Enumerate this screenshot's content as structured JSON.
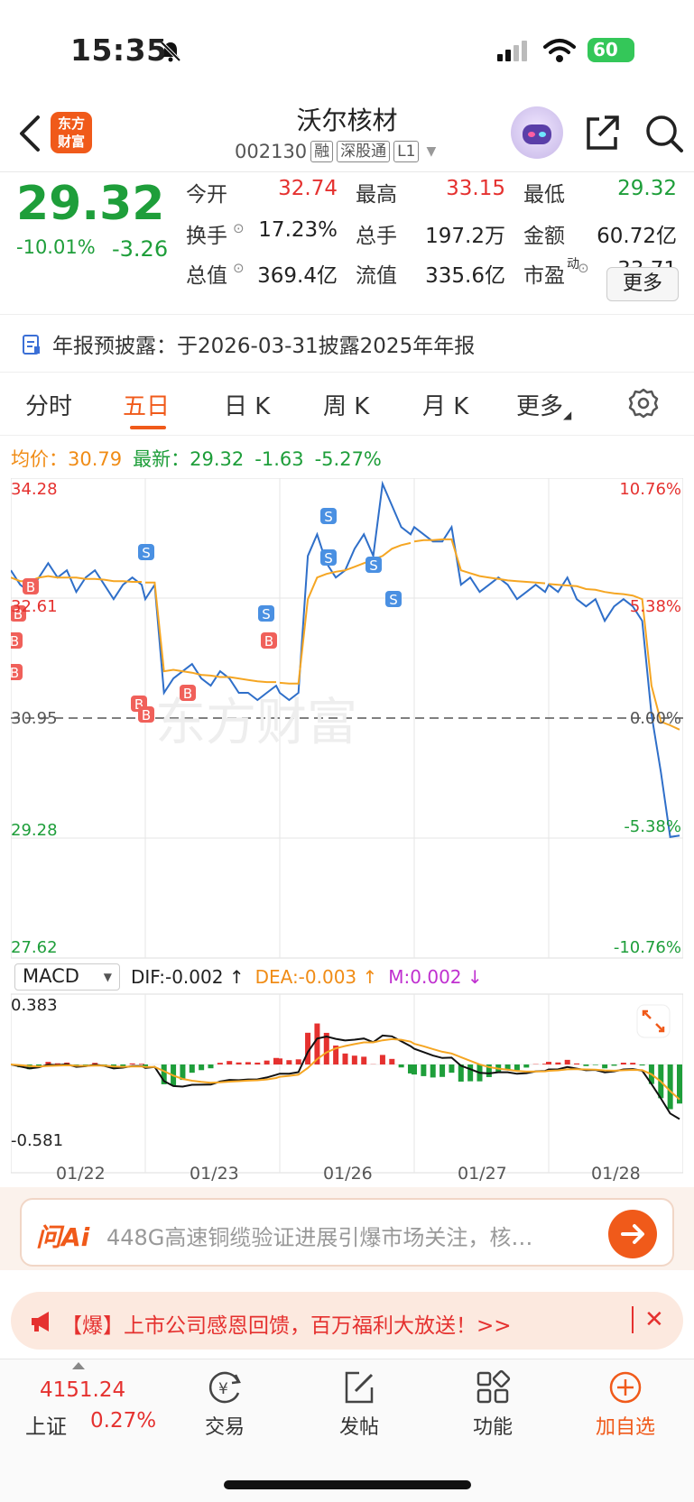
{
  "status_bar": {
    "time": "15:35",
    "battery": "60"
  },
  "header": {
    "title": "沃尔核材",
    "code": "002130",
    "tags": [
      "融",
      "深股通",
      "L1"
    ],
    "logo_text": "东方\n财富"
  },
  "quote": {
    "price": "29.32",
    "change_pct": "-10.01%",
    "change_val": "-3.26",
    "fields": [
      {
        "label": "今开",
        "value": "32.74",
        "color": "#e5312f"
      },
      {
        "label": "最高",
        "value": "33.15",
        "color": "#e5312f"
      },
      {
        "label": "最低",
        "value": "29.32",
        "color": "#1e9e3a"
      },
      {
        "label": "换手",
        "value": "17.23%",
        "color": "#222222"
      },
      {
        "label": "总手",
        "value": "197.2万",
        "color": "#222222"
      },
      {
        "label": "金额",
        "value": "60.72亿",
        "color": "#222222"
      },
      {
        "label": "总值",
        "value": "369.4亿",
        "color": "#222222"
      },
      {
        "label": "流值",
        "value": "335.6亿",
        "color": "#222222"
      },
      {
        "label": "市盈",
        "value": "33.71",
        "color": "#222222"
      }
    ],
    "pe_superscript": "动",
    "more_button": "更多"
  },
  "notice": {
    "text": "年报预披露：于2026-03-31披露2025年年报"
  },
  "tabs": [
    "分时",
    "五日",
    "日 K",
    "周 K",
    "月 K",
    "更多"
  ],
  "active_tab": "五日",
  "legend": {
    "avg_label": "均价：",
    "avg_value": "30.79",
    "last_label": "最新：",
    "last_value": "29.32",
    "chg": "-1.63",
    "pct": "-5.27%"
  },
  "chart_data": {
    "type": "line",
    "title": "",
    "y_left_ticks": [
      "34.28",
      "32.61",
      "30.95",
      "29.28",
      "27.62"
    ],
    "y_right_ticks": [
      "10.76%",
      "5.38%",
      "0.00%",
      "-5.38%",
      "-10.76%"
    ],
    "ylim": [
      27.62,
      34.28
    ],
    "prev_close": 30.95,
    "x_days": [
      "01/22",
      "01/23",
      "01/26",
      "01/27",
      "01/28"
    ],
    "series": [
      {
        "values": [
          33.0,
          32.8,
          32.7,
          32.9,
          33.1,
          32.9,
          33.0,
          32.7,
          32.9,
          33.0,
          32.8,
          32.6,
          32.8,
          32.9,
          32.8,
          32.6,
          32.8,
          31.3,
          31.5,
          31.6,
          31.7,
          31.5,
          31.4,
          31.6,
          31.5,
          31.3,
          31.3,
          31.2,
          31.3,
          31.4,
          31.3,
          31.2,
          31.3,
          33.2,
          33.5,
          33.1,
          32.9,
          33.0,
          33.3,
          33.5,
          33.2,
          34.2,
          33.9,
          33.6,
          33.5,
          33.6,
          33.5,
          33.4,
          33.4,
          33.6,
          32.8,
          32.9,
          32.7,
          32.8,
          32.9,
          32.8,
          32.6,
          32.7,
          32.8,
          32.7,
          32.8,
          32.7,
          32.9,
          32.6,
          32.5,
          32.6,
          32.3,
          32.5,
          32.6,
          32.5,
          32.3,
          31.0,
          30.2,
          29.3,
          29.32
        ]
      },
      {
        "values": [
          32.9,
          32.85,
          32.85,
          32.9,
          32.92,
          32.9,
          32.9,
          32.9,
          32.88,
          32.88,
          32.87,
          32.85,
          32.85,
          32.84,
          32.84,
          32.83,
          32.83,
          31.6,
          31.62,
          31.6,
          31.58,
          31.55,
          31.54,
          31.52,
          31.52,
          31.5,
          31.48,
          31.46,
          31.45,
          31.45,
          31.44,
          31.43,
          31.43,
          32.6,
          32.9,
          32.95,
          32.98,
          33.0,
          33.05,
          33.1,
          33.15,
          33.2,
          33.3,
          33.35,
          33.38,
          33.4,
          33.42,
          33.42,
          33.43,
          33.43,
          33.0,
          32.96,
          32.92,
          32.9,
          32.88,
          32.86,
          32.85,
          32.84,
          32.83,
          32.82,
          32.81,
          32.8,
          32.79,
          32.78,
          32.74,
          32.73,
          32.7,
          32.68,
          32.67,
          32.65,
          32.6,
          31.4,
          30.9,
          30.85,
          30.79
        ]
      }
    ]
  },
  "macd": {
    "select": "MACD",
    "dif": "DIF:-0.002 ↑",
    "dea": "DEA:-0.003 ↑",
    "m": "M:0.002 ↓",
    "top": "0.383",
    "bottom": "-0.581"
  },
  "ai": {
    "logo": "问Ai",
    "text": "448G高速铜缆验证进展引爆市场关注，核…"
  },
  "promo": {
    "text": "【爆】上市公司感恩回馈，百万福利大放送！>>",
    "close": "✕"
  },
  "bottom_nav": {
    "index_value": "4151.24",
    "index_name": "上证",
    "index_pct": "0.27%",
    "items": [
      "交易",
      "发帖",
      "功能",
      "加自选"
    ]
  },
  "colors": {
    "up": "#e5312f",
    "down": "#1e9e3a",
    "accent": "#f05a1a",
    "price_line": "#2f6fc9",
    "avg_line": "#f5a623"
  },
  "icons": [
    "back-icon",
    "share-icon",
    "search-icon",
    "settings-icon",
    "notice-icon",
    "bell-off-icon",
    "megaphone-icon",
    "expand-icon",
    "arrow-right-icon"
  ]
}
